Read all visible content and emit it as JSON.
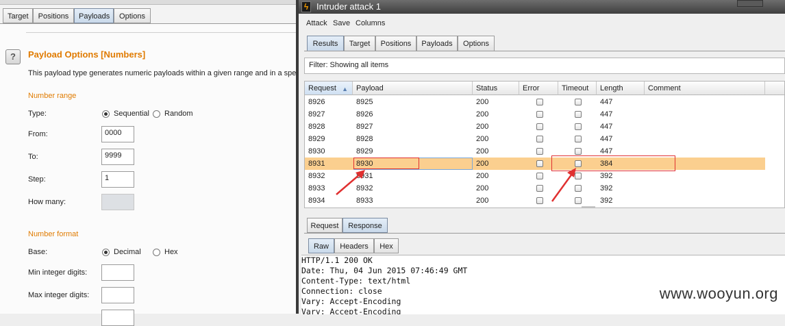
{
  "left_panel": {
    "tabs": [
      {
        "label": "Target"
      },
      {
        "label": "Positions"
      },
      {
        "label": "Payloads",
        "active": true
      },
      {
        "label": "Options"
      }
    ],
    "help_icon_glyph": "?",
    "title": "Payload Options [Numbers]",
    "description": "This payload type generates numeric payloads within a given range and in a spe",
    "number_range": {
      "heading": "Number range",
      "type_label": "Type:",
      "type_options": [
        "Sequential",
        "Random"
      ],
      "type_selected": "Sequential",
      "from_label": "From:",
      "from_value": "0000",
      "to_label": "To:",
      "to_value": "9999",
      "step_label": "Step:",
      "step_value": "1",
      "howmany_label": "How many:",
      "howmany_value": ""
    },
    "number_format": {
      "heading": "Number format",
      "base_label": "Base:",
      "base_options": [
        "Decimal",
        "Hex"
      ],
      "base_selected": "Decimal",
      "min_int_label": "Min integer digits:",
      "min_int_value": "",
      "max_int_label": "Max integer digits:",
      "max_int_value": ""
    },
    "heading_color": "#e07b00"
  },
  "attack_window": {
    "title": "Intruder attack 1",
    "menu": [
      "Attack",
      "Save",
      "Columns"
    ],
    "tabs": [
      {
        "label": "Results",
        "active": true
      },
      {
        "label": "Target"
      },
      {
        "label": "Positions"
      },
      {
        "label": "Payloads"
      },
      {
        "label": "Options"
      }
    ],
    "filter_text": "Filter: Showing all items",
    "table": {
      "columns": [
        "Request",
        "Payload",
        "Status",
        "Error",
        "Timeout",
        "Length",
        "Comment"
      ],
      "sorted_column": "Request",
      "rows": [
        {
          "request": "8926",
          "payload": "8925",
          "status": "200",
          "error": false,
          "timeout": false,
          "length": "447",
          "comment": ""
        },
        {
          "request": "8927",
          "payload": "8926",
          "status": "200",
          "error": false,
          "timeout": false,
          "length": "447",
          "comment": ""
        },
        {
          "request": "8928",
          "payload": "8927",
          "status": "200",
          "error": false,
          "timeout": false,
          "length": "447",
          "comment": ""
        },
        {
          "request": "8929",
          "payload": "8928",
          "status": "200",
          "error": false,
          "timeout": false,
          "length": "447",
          "comment": ""
        },
        {
          "request": "8930",
          "payload": "8929",
          "status": "200",
          "error": false,
          "timeout": false,
          "length": "447",
          "comment": ""
        },
        {
          "request": "8931",
          "payload": "8930",
          "status": "200",
          "error": false,
          "timeout": false,
          "length": "384",
          "comment": "",
          "selected": true
        },
        {
          "request": "8932",
          "payload": "8931",
          "status": "200",
          "error": false,
          "timeout": false,
          "length": "392",
          "comment": ""
        },
        {
          "request": "8933",
          "payload": "8932",
          "status": "200",
          "error": false,
          "timeout": false,
          "length": "392",
          "comment": ""
        },
        {
          "request": "8934",
          "payload": "8933",
          "status": "200",
          "error": false,
          "timeout": false,
          "length": "392",
          "comment": ""
        }
      ],
      "selected_row_color": "#fbcf8f"
    },
    "detail_tabs": [
      {
        "label": "Request"
      },
      {
        "label": "Response",
        "active": true
      }
    ],
    "view_tabs": [
      {
        "label": "Raw",
        "active": true
      },
      {
        "label": "Headers"
      },
      {
        "label": "Hex"
      }
    ],
    "response_lines": [
      "HTTP/1.1 200 OK",
      "Date: Thu, 04 Jun 2015 07:46:49 GMT",
      "Content-Type: text/html",
      "Connection: close",
      "Vary: Accept-Encoding",
      "Vary: Accept-Encoding"
    ]
  },
  "annotations": {
    "highlight_color": "#e03030",
    "arrow_color": "#e03030"
  },
  "watermark": "www.wooyun.org"
}
